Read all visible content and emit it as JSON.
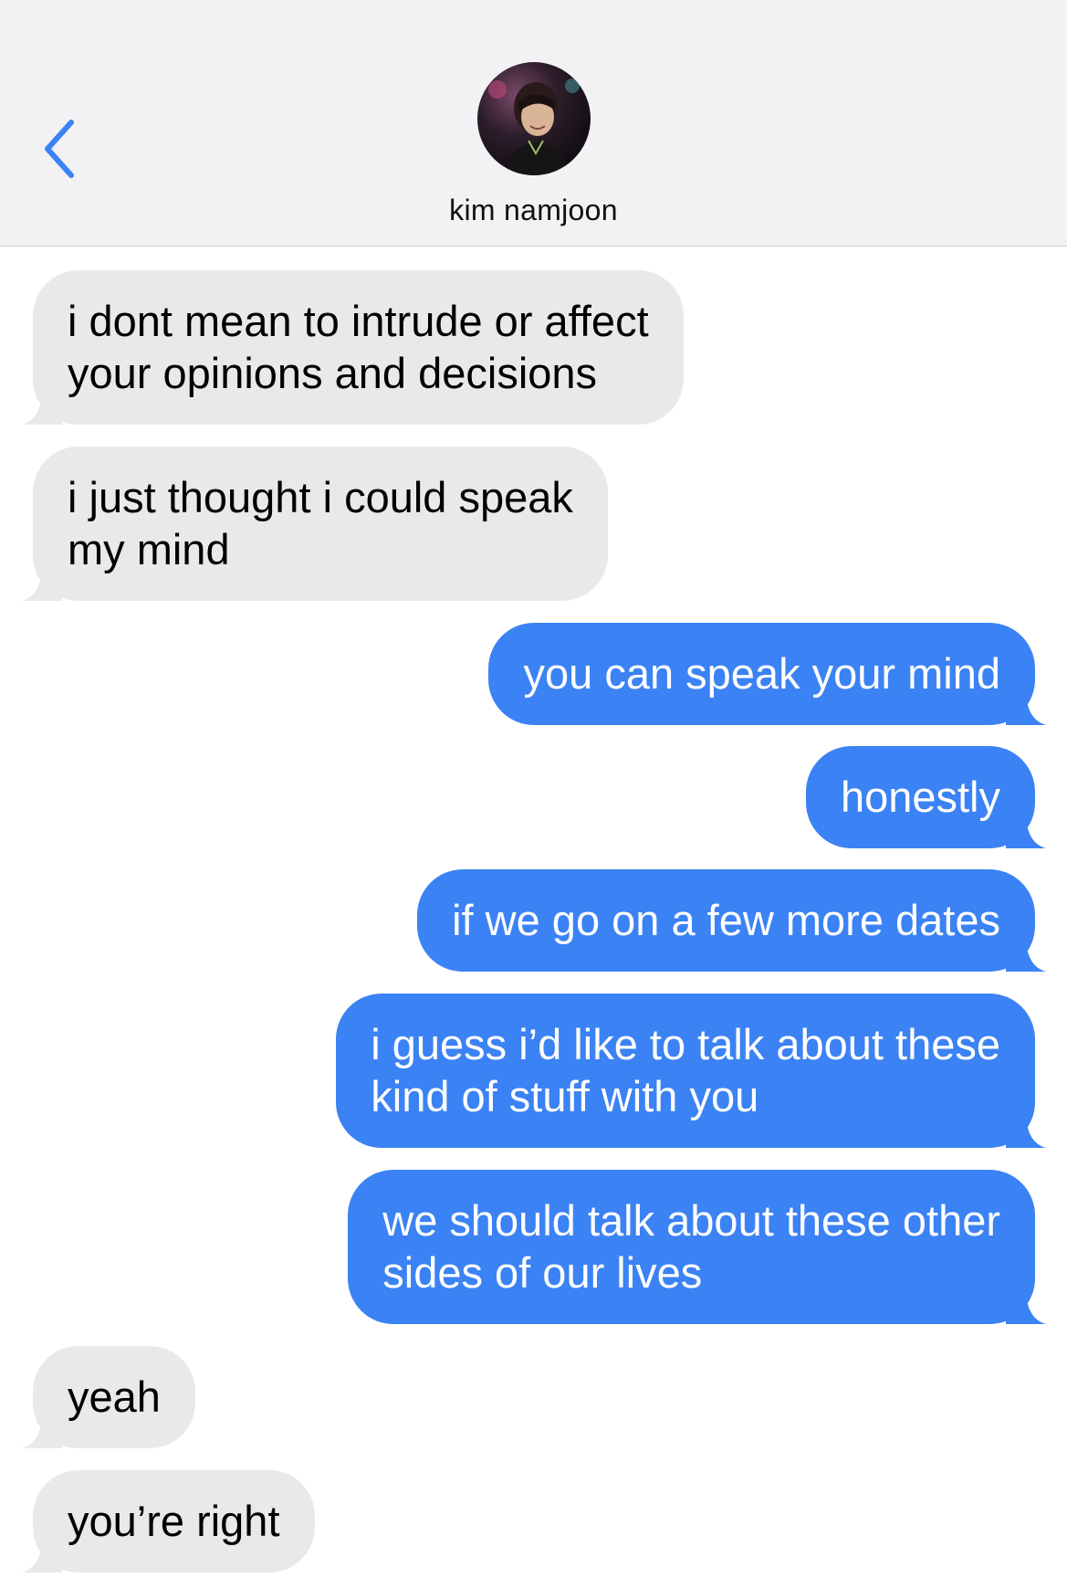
{
  "header": {
    "back_icon": "chevron-left-icon",
    "contact_name": "kim namjoon",
    "accent_color": "#3b82f4"
  },
  "messages": [
    {
      "direction": "incoming",
      "lines": [
        "i dont mean to intrude or affect",
        "your opinions and decisions"
      ]
    },
    {
      "direction": "incoming",
      "lines": [
        "i just thought i could speak",
        "my mind"
      ]
    },
    {
      "direction": "outgoing",
      "lines": [
        "you can speak your mind"
      ]
    },
    {
      "direction": "outgoing",
      "lines": [
        "honestly"
      ]
    },
    {
      "direction": "outgoing",
      "lines": [
        "if we go on a few more dates"
      ]
    },
    {
      "direction": "outgoing",
      "lines": [
        "i guess i’d like to talk about these",
        "kind of stuff with you"
      ]
    },
    {
      "direction": "outgoing",
      "lines": [
        "we should talk about these other",
        "sides of our lives"
      ]
    },
    {
      "direction": "incoming",
      "lines": [
        "yeah"
      ]
    },
    {
      "direction": "incoming",
      "lines": [
        "you’re right"
      ]
    }
  ],
  "colors": {
    "incoming_bubble": "#e9e9eb",
    "outgoing_bubble": "#3b82f4",
    "header_background": "#f2f2f4"
  }
}
